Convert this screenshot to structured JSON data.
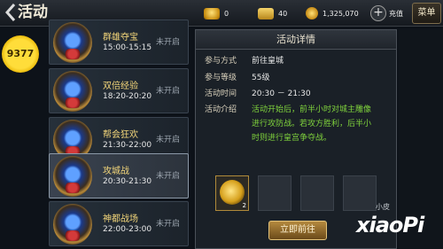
{
  "header": {
    "back_icon": "back-arrow-icon",
    "title": "活动",
    "resources": [
      {
        "icon": "ingot-icon",
        "value": "0"
      },
      {
        "icon": "gold-bag-icon",
        "value": "40"
      },
      {
        "icon": "coin-icon",
        "value": "1,325,070"
      }
    ],
    "recharge_label": "充值",
    "menu_label": "菜单"
  },
  "logo_text": "9377",
  "activities": [
    {
      "name": "群雄夺宝",
      "time": "15:00-15:15",
      "status": "未开启",
      "selected": false
    },
    {
      "name": "双倍经验",
      "time": "18:20-20:20",
      "status": "未开启",
      "selected": false
    },
    {
      "name": "帮会狂欢",
      "time": "21:30-22:00",
      "status": "未开启",
      "selected": false
    },
    {
      "name": "攻城战",
      "time": "20:30-21:30",
      "status": "未开启",
      "selected": true
    },
    {
      "name": "神都战场",
      "time": "22:00-23:00",
      "status": "未开启",
      "selected": false
    }
  ],
  "detail": {
    "heading": "活动详情",
    "rows": [
      {
        "label": "参与方式",
        "value": "前往皇城"
      },
      {
        "label": "参与等级",
        "value": "55级"
      },
      {
        "label": "活动时间",
        "value": "20:30 － 21:30"
      },
      {
        "label": "活动介绍",
        "value": ""
      }
    ],
    "description_lines": [
      "活动开始后，前半小时对城主雕像",
      "进行攻防战。若攻方胜利，后半小",
      "时则进行皇宫争夺战。"
    ],
    "reward_count": "2",
    "go_button": "立即前往"
  },
  "watermark": {
    "small": "小皮",
    "big": "xiaoPi"
  },
  "colors": {
    "accent_gold": "#f3d67a",
    "desc_green": "#7fd23c",
    "panel_bg": "#1a2027"
  }
}
